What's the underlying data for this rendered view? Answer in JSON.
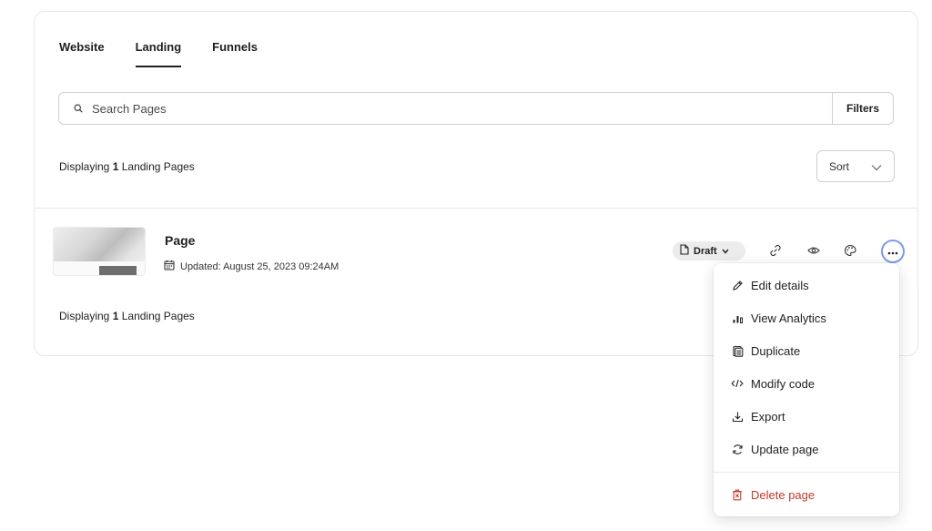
{
  "tabs": [
    {
      "label": "Website",
      "active": false
    },
    {
      "label": "Landing",
      "active": true
    },
    {
      "label": "Funnels",
      "active": false
    }
  ],
  "search": {
    "placeholder": "Search Pages",
    "value": ""
  },
  "filters_label": "Filters",
  "sort_label": "Sort",
  "count_prefix": "Displaying",
  "count_value": "1",
  "count_suffix": "Landing Pages",
  "pages": [
    {
      "name": "Page",
      "updated": "Updated: August 25, 2023 09:24AM",
      "status": "Draft"
    }
  ],
  "row_actions": [
    "link-icon",
    "eye-icon",
    "palette-icon",
    "more-icon"
  ],
  "menu": {
    "items": [
      {
        "label": "Edit details",
        "icon": "pencil-icon"
      },
      {
        "label": "View Analytics",
        "icon": "analytics-icon"
      },
      {
        "label": "Duplicate",
        "icon": "duplicate-icon"
      },
      {
        "label": "Modify code",
        "icon": "code-icon"
      },
      {
        "label": "Export",
        "icon": "export-icon"
      },
      {
        "label": "Update page",
        "icon": "refresh-icon"
      }
    ],
    "danger": {
      "label": "Delete page",
      "icon": "trash-icon"
    }
  },
  "colors": {
    "accent_ring": "#7b9be6",
    "danger": "#c0392b",
    "border": "#cfcfcf"
  }
}
